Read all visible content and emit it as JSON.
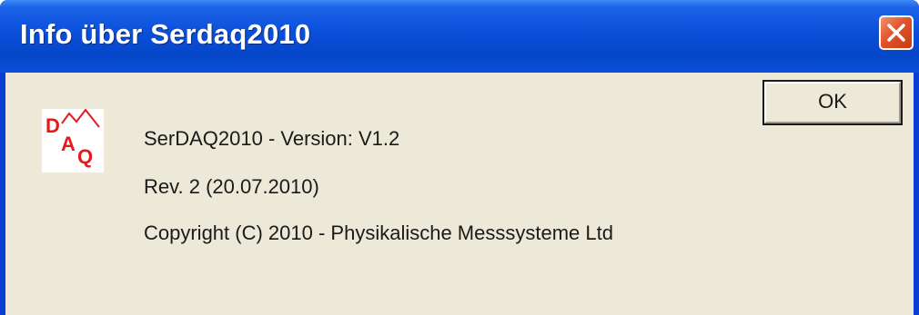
{
  "window": {
    "title": "Info über Serdaq2010",
    "close_icon": "close-icon"
  },
  "logo": {
    "letters": [
      "D",
      "A",
      "Q"
    ],
    "icon": "daq-logo-icon",
    "color": "#e8191c"
  },
  "info": {
    "version": "SerDAQ2010 - Version: V1.2",
    "revision": "Rev. 2 (20.07.2010)",
    "copyright": "Copyright (C) 2010 - Physikalische Messsysteme Ltd"
  },
  "buttons": {
    "ok_label": "OK"
  },
  "colors": {
    "titlebar": "#0a4fd8",
    "dialog_bg": "#ece9d8",
    "close_button": "#e0542b"
  }
}
